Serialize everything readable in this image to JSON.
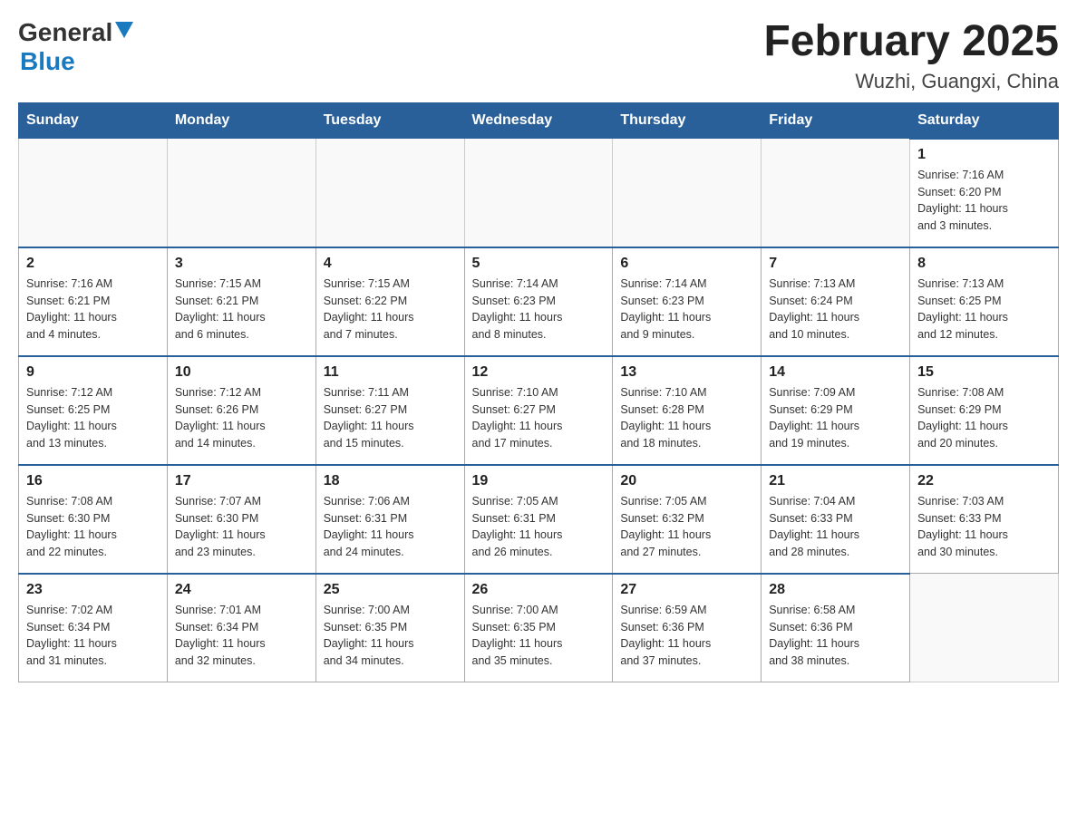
{
  "header": {
    "logo_general": "General",
    "logo_blue": "Blue",
    "month_title": "February 2025",
    "location": "Wuzhi, Guangxi, China"
  },
  "weekdays": [
    "Sunday",
    "Monday",
    "Tuesday",
    "Wednesday",
    "Thursday",
    "Friday",
    "Saturday"
  ],
  "weeks": [
    [
      {
        "day": "",
        "info": ""
      },
      {
        "day": "",
        "info": ""
      },
      {
        "day": "",
        "info": ""
      },
      {
        "day": "",
        "info": ""
      },
      {
        "day": "",
        "info": ""
      },
      {
        "day": "",
        "info": ""
      },
      {
        "day": "1",
        "info": "Sunrise: 7:16 AM\nSunset: 6:20 PM\nDaylight: 11 hours\nand 3 minutes."
      }
    ],
    [
      {
        "day": "2",
        "info": "Sunrise: 7:16 AM\nSunset: 6:21 PM\nDaylight: 11 hours\nand 4 minutes."
      },
      {
        "day": "3",
        "info": "Sunrise: 7:15 AM\nSunset: 6:21 PM\nDaylight: 11 hours\nand 6 minutes."
      },
      {
        "day": "4",
        "info": "Sunrise: 7:15 AM\nSunset: 6:22 PM\nDaylight: 11 hours\nand 7 minutes."
      },
      {
        "day": "5",
        "info": "Sunrise: 7:14 AM\nSunset: 6:23 PM\nDaylight: 11 hours\nand 8 minutes."
      },
      {
        "day": "6",
        "info": "Sunrise: 7:14 AM\nSunset: 6:23 PM\nDaylight: 11 hours\nand 9 minutes."
      },
      {
        "day": "7",
        "info": "Sunrise: 7:13 AM\nSunset: 6:24 PM\nDaylight: 11 hours\nand 10 minutes."
      },
      {
        "day": "8",
        "info": "Sunrise: 7:13 AM\nSunset: 6:25 PM\nDaylight: 11 hours\nand 12 minutes."
      }
    ],
    [
      {
        "day": "9",
        "info": "Sunrise: 7:12 AM\nSunset: 6:25 PM\nDaylight: 11 hours\nand 13 minutes."
      },
      {
        "day": "10",
        "info": "Sunrise: 7:12 AM\nSunset: 6:26 PM\nDaylight: 11 hours\nand 14 minutes."
      },
      {
        "day": "11",
        "info": "Sunrise: 7:11 AM\nSunset: 6:27 PM\nDaylight: 11 hours\nand 15 minutes."
      },
      {
        "day": "12",
        "info": "Sunrise: 7:10 AM\nSunset: 6:27 PM\nDaylight: 11 hours\nand 17 minutes."
      },
      {
        "day": "13",
        "info": "Sunrise: 7:10 AM\nSunset: 6:28 PM\nDaylight: 11 hours\nand 18 minutes."
      },
      {
        "day": "14",
        "info": "Sunrise: 7:09 AM\nSunset: 6:29 PM\nDaylight: 11 hours\nand 19 minutes."
      },
      {
        "day": "15",
        "info": "Sunrise: 7:08 AM\nSunset: 6:29 PM\nDaylight: 11 hours\nand 20 minutes."
      }
    ],
    [
      {
        "day": "16",
        "info": "Sunrise: 7:08 AM\nSunset: 6:30 PM\nDaylight: 11 hours\nand 22 minutes."
      },
      {
        "day": "17",
        "info": "Sunrise: 7:07 AM\nSunset: 6:30 PM\nDaylight: 11 hours\nand 23 minutes."
      },
      {
        "day": "18",
        "info": "Sunrise: 7:06 AM\nSunset: 6:31 PM\nDaylight: 11 hours\nand 24 minutes."
      },
      {
        "day": "19",
        "info": "Sunrise: 7:05 AM\nSunset: 6:31 PM\nDaylight: 11 hours\nand 26 minutes."
      },
      {
        "day": "20",
        "info": "Sunrise: 7:05 AM\nSunset: 6:32 PM\nDaylight: 11 hours\nand 27 minutes."
      },
      {
        "day": "21",
        "info": "Sunrise: 7:04 AM\nSunset: 6:33 PM\nDaylight: 11 hours\nand 28 minutes."
      },
      {
        "day": "22",
        "info": "Sunrise: 7:03 AM\nSunset: 6:33 PM\nDaylight: 11 hours\nand 30 minutes."
      }
    ],
    [
      {
        "day": "23",
        "info": "Sunrise: 7:02 AM\nSunset: 6:34 PM\nDaylight: 11 hours\nand 31 minutes."
      },
      {
        "day": "24",
        "info": "Sunrise: 7:01 AM\nSunset: 6:34 PM\nDaylight: 11 hours\nand 32 minutes."
      },
      {
        "day": "25",
        "info": "Sunrise: 7:00 AM\nSunset: 6:35 PM\nDaylight: 11 hours\nand 34 minutes."
      },
      {
        "day": "26",
        "info": "Sunrise: 7:00 AM\nSunset: 6:35 PM\nDaylight: 11 hours\nand 35 minutes."
      },
      {
        "day": "27",
        "info": "Sunrise: 6:59 AM\nSunset: 6:36 PM\nDaylight: 11 hours\nand 37 minutes."
      },
      {
        "day": "28",
        "info": "Sunrise: 6:58 AM\nSunset: 6:36 PM\nDaylight: 11 hours\nand 38 minutes."
      },
      {
        "day": "",
        "info": ""
      }
    ]
  ]
}
